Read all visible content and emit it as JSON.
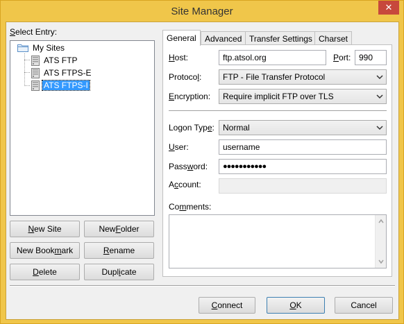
{
  "window": {
    "title": "Site Manager",
    "close_glyph": "✕"
  },
  "entries": {
    "label_prefix": "S",
    "label_rest": "elect Entry:",
    "tree": [
      {
        "label": "My Sites",
        "icon": "folder-icon"
      },
      {
        "label": "ATS FTP",
        "icon": "server-icon"
      },
      {
        "label": "ATS FTPS-E",
        "icon": "server-icon"
      },
      {
        "label": "ATS FTPS-I",
        "icon": "server-icon",
        "selected": true
      }
    ]
  },
  "left_buttons": {
    "new_site": {
      "ul": "N",
      "rest": "ew Site"
    },
    "new_folder": {
      "pre": "New ",
      "ul": "F",
      "rest": "older"
    },
    "new_bookmark": {
      "pre": "New Book",
      "ul": "m",
      "rest": "ark"
    },
    "rename": {
      "ul": "R",
      "rest": "ename"
    },
    "delete": {
      "ul": "D",
      "rest": "elete"
    },
    "duplicate": {
      "pre": "Dupl",
      "ul": "i",
      "rest": "cate"
    }
  },
  "tabs": [
    "General",
    "Advanced",
    "Transfer Settings",
    "Charset"
  ],
  "general": {
    "host_label": {
      "ul": "H",
      "rest": "ost:"
    },
    "host_value": "ftp.atsol.org",
    "port_label": {
      "ul": "P",
      "rest": "ort:"
    },
    "port_value": "990",
    "protocol_label": {
      "pre": "Protoco",
      "ul": "l",
      "rest": ":"
    },
    "protocol_value": "FTP - File Transfer Protocol",
    "encryption_label": {
      "ul": "E",
      "rest": "ncryption:"
    },
    "encryption_value": "Require implicit FTP over TLS",
    "logon_type_label": {
      "pre": "Logon Typ",
      "ul": "e",
      "rest": ":"
    },
    "logon_type_value": "Normal",
    "user_label": {
      "ul": "U",
      "rest": "ser:"
    },
    "user_value": "username",
    "password_label": {
      "pre": "Pass",
      "ul": "w",
      "rest": "ord:"
    },
    "password_value": "●●●●●●●●●●●",
    "account_label": {
      "pre": "A",
      "ul": "c",
      "rest": "count:"
    },
    "account_value": "",
    "comments_label": {
      "pre": "Co",
      "ul": "m",
      "rest": "ments:"
    },
    "comments_value": ""
  },
  "bottom_buttons": {
    "connect": {
      "ul": "C",
      "rest": "onnect"
    },
    "ok": {
      "ul": "O",
      "rest": "K"
    },
    "cancel": "Cancel"
  },
  "colors": {
    "frame": "#f0c64a",
    "selection": "#3399ff",
    "close": "#c7483c"
  }
}
